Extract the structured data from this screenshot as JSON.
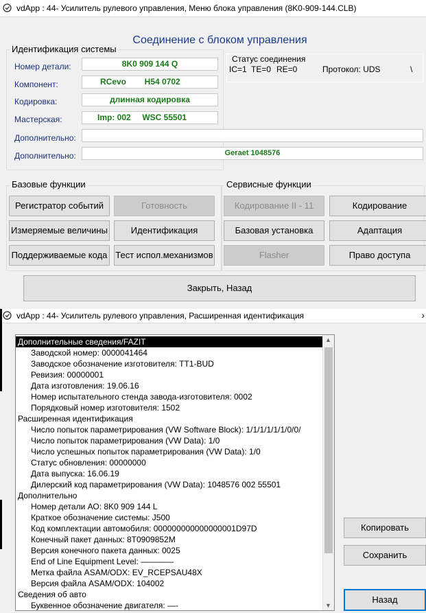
{
  "window1": {
    "title": "vdApp : 44- Усилитель рулевого управления,  Меню блока управления (8K0-909-144.CLB)",
    "heading": "Соединение с блоком управления",
    "ident_group_label": "Идентификация системы",
    "fields": [
      {
        "label": "Номер детали:",
        "value": "8K0 909 144 Q"
      },
      {
        "label": "Компонент:",
        "value": "RCevo        H54 0702"
      },
      {
        "label": "Кодировка:",
        "value": "длинная кодировка"
      },
      {
        "label": "Мастерская:",
        "value": "Imp: 002     WSC 55501"
      },
      {
        "label": "Дополнительно:",
        "value": ""
      },
      {
        "label": "Дополнительно:",
        "value": "Geraet 1048576"
      }
    ],
    "status": {
      "label": "Статус соединения",
      "ic": "IC=1",
      "te": "TE=0",
      "re": "RE=0",
      "protocol": "Протокол: UDS",
      "spinner": "\\"
    },
    "basic_group_label": "Базовые функции",
    "service_group_label": "Сервисные функции",
    "basic_buttons": [
      {
        "label": "Регистратор событий",
        "enabled": true
      },
      {
        "label": "Готовность",
        "enabled": false
      },
      {
        "label": "Измеряемые величины",
        "enabled": true
      },
      {
        "label": "Идентификация",
        "enabled": true
      },
      {
        "label": "Поддерживаемые кода",
        "enabled": true
      },
      {
        "label": "Тест испол.механизмов",
        "enabled": true
      }
    ],
    "service_buttons": [
      {
        "label": "Кодирование II - 11",
        "enabled": false
      },
      {
        "label": "Кодирование",
        "enabled": true
      },
      {
        "label": "Базовая установка",
        "enabled": true
      },
      {
        "label": "Адаптация",
        "enabled": true
      },
      {
        "label": "Flasher",
        "enabled": false
      },
      {
        "label": "Право доступа",
        "enabled": true
      }
    ],
    "close_button": "Закрыть, Назад"
  },
  "window2": {
    "title": "vdApp : 44- Усилитель рулевого управления,  Расширенная идентификация",
    "list": [
      {
        "text": "Дополнительные сведения/FAZIT",
        "type": "header-selected"
      },
      {
        "text": "Заводской номер: 0000041464",
        "type": "item"
      },
      {
        "text": "Заводское обозначение изготовителя: TT1-BUD",
        "type": "item"
      },
      {
        "text": "Ревизия: 00000001",
        "type": "item"
      },
      {
        "text": "Дата изготовления: 19.06.16",
        "type": "item"
      },
      {
        "text": "Номер испытательного стенда завода-изготовителя: 0002",
        "type": "item"
      },
      {
        "text": "Порядковый номер изготовителя: 1502",
        "type": "item"
      },
      {
        "text": "Расширенная идентификация",
        "type": "section"
      },
      {
        "text": "Число попыток параметрирования (VW Software Block): 1/1/1/1/1/1/0/0/",
        "type": "item"
      },
      {
        "text": "Число попыток параметрирования (VW Data): 1/0",
        "type": "item"
      },
      {
        "text": "Число успешных попыток параметрирования (VW Data): 1/0",
        "type": "item"
      },
      {
        "text": "Статус обновления: 00000000",
        "type": "item"
      },
      {
        "text": "Дата выпуска: 16.06.19",
        "type": "item"
      },
      {
        "text": "Дилерский код параметрирования (VW Data): 1048576 002 55501",
        "type": "item"
      },
      {
        "text": "Дополнительно",
        "type": "section"
      },
      {
        "text": "Номер детали АО: 8K0 909 144 L",
        "type": "item"
      },
      {
        "text": "Краткое обозначение системы: J500",
        "type": "item"
      },
      {
        "text": "Код комплектации автомобиля: 000000000000000001D97D",
        "type": "item"
      },
      {
        "text": "Конечный пакет данных: 8T0909852M",
        "type": "item"
      },
      {
        "text": "Версия конечного пакета данных: 0025",
        "type": "item"
      },
      {
        "text": "End of Line Equipment Level: ————",
        "type": "item"
      },
      {
        "text": "Метка файла ASAM/ODX: EV_RCEPSAU48X",
        "type": "item"
      },
      {
        "text": "Версия файла ASAM/ODX: 104002",
        "type": "item"
      },
      {
        "text": "Сведения об авто",
        "type": "section"
      },
      {
        "text": "Буквенное обозначение двигателя: —-",
        "type": "item"
      }
    ],
    "buttons": {
      "copy": "Копировать",
      "save": "Сохранить",
      "back": "Назад"
    }
  }
}
